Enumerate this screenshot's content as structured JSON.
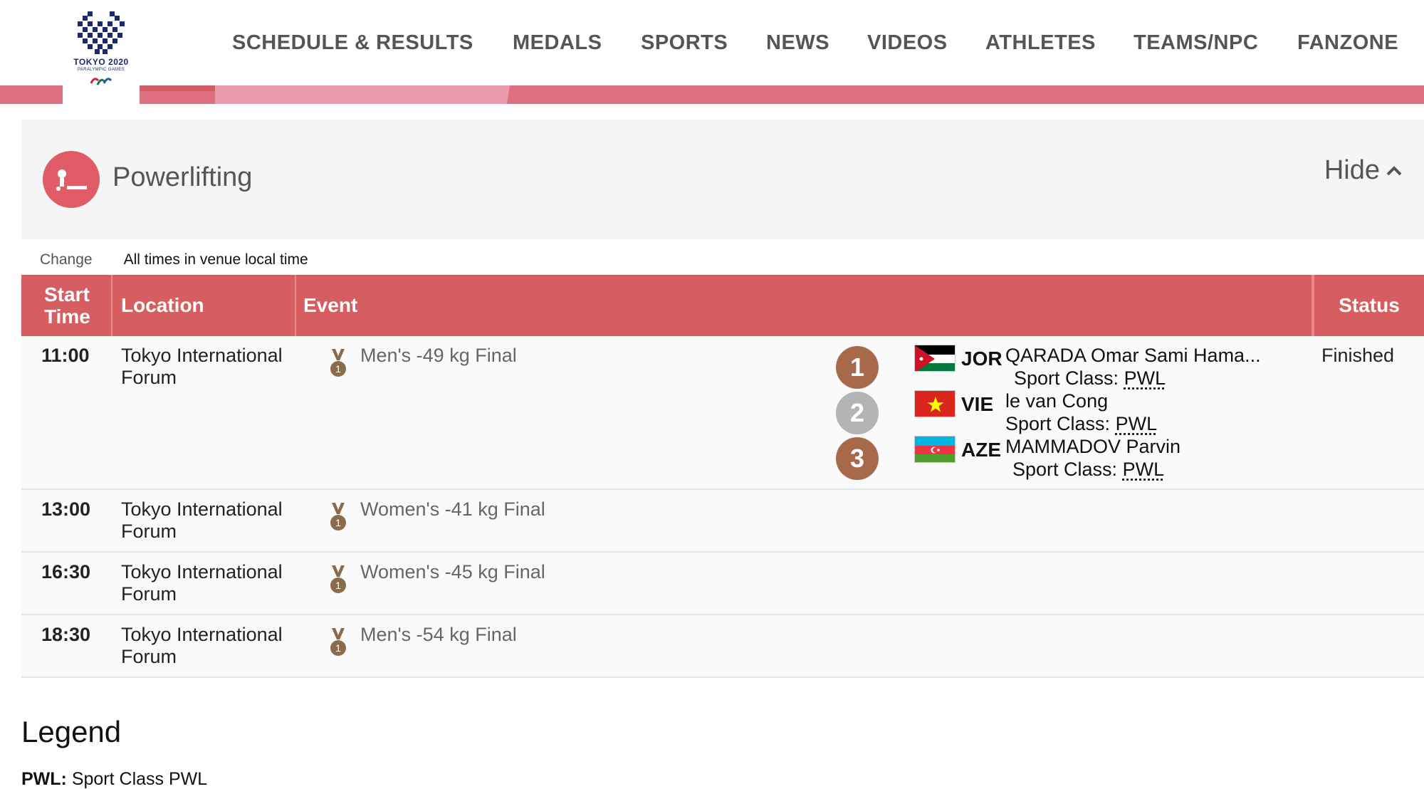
{
  "brand": {
    "logo_text": "TOKYO 2020",
    "logo_subtext": "PARALYMPIC GAMES",
    "accent_color": "#d65e61",
    "stripe_color": "#df7080"
  },
  "nav": {
    "items": [
      {
        "label": "SCHEDULE & RESULTS"
      },
      {
        "label": "MEDALS"
      },
      {
        "label": "SPORTS"
      },
      {
        "label": "NEWS"
      },
      {
        "label": "VIDEOS"
      },
      {
        "label": "ATHLETES"
      },
      {
        "label": "TEAMS/NPC"
      },
      {
        "label": "FANZONE"
      }
    ]
  },
  "sport": {
    "icon": "powerlifting-icon",
    "title": "Powerlifting",
    "hide_label": "Hide"
  },
  "meta": {
    "change_label": "Change",
    "timezone_note": "All times in venue local time"
  },
  "table": {
    "headers": {
      "start_time_line1": "Start",
      "start_time_line2": "Time",
      "location": "Location",
      "event": "Event",
      "status": "Status"
    },
    "rows": [
      {
        "time": "11:00",
        "location": "Tokyo International Forum",
        "event": "Men's -49 kg Final",
        "status": "Finished",
        "results": [
          {
            "rank": "1",
            "medal": "gold",
            "noc": "JOR",
            "name": "QARADA Omar Sami Hama...",
            "class_label": "Sport Class:",
            "class": "PWL"
          },
          {
            "rank": "2",
            "medal": "silver",
            "noc": "VIE",
            "name": "le van Cong",
            "class_label": "Sport Class:",
            "class": "PWL"
          },
          {
            "rank": "3",
            "medal": "bronze",
            "noc": "AZE",
            "name": "MAMMADOV Parvin",
            "class_label": "Sport Class:",
            "class": "PWL"
          }
        ]
      },
      {
        "time": "13:00",
        "location": "Tokyo International Forum",
        "event": "Women's -41 kg Final",
        "status": ""
      },
      {
        "time": "16:30",
        "location": "Tokyo International Forum",
        "event": "Women's -45 kg Final",
        "status": ""
      },
      {
        "time": "18:30",
        "location": "Tokyo International Forum",
        "event": "Men's -54 kg Final",
        "status": ""
      }
    ]
  },
  "legend": {
    "title": "Legend",
    "items": [
      {
        "code": "PWL:",
        "description": "Sport Class PWL"
      }
    ]
  }
}
